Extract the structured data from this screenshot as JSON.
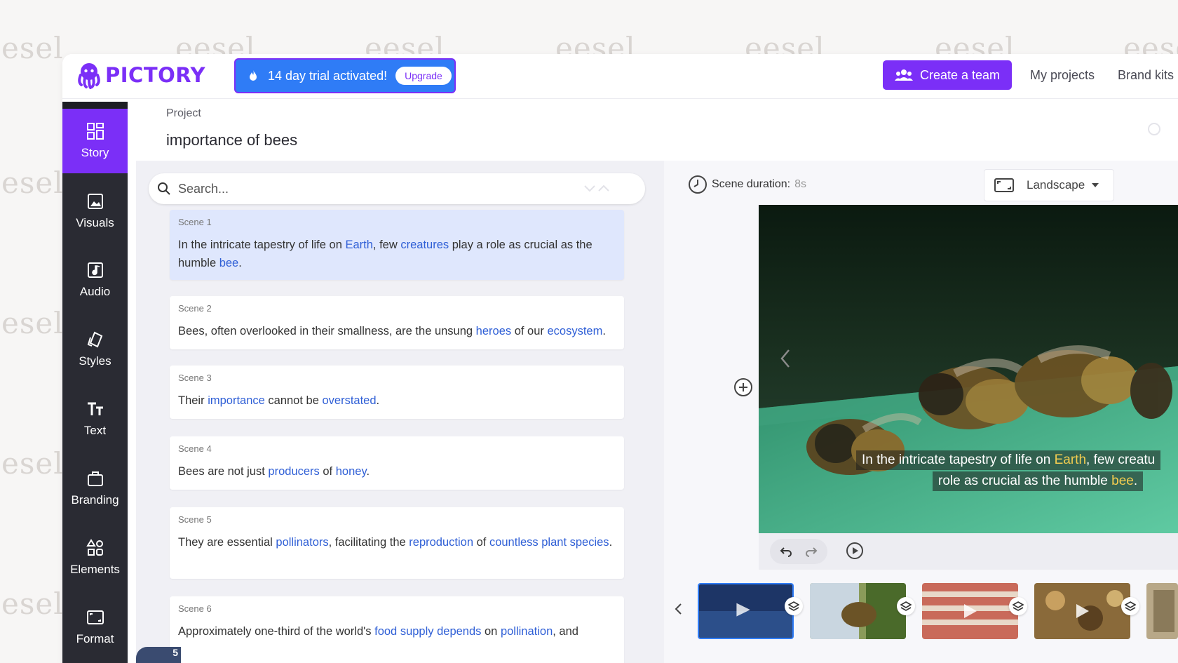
{
  "watermark": {
    "text_left": "esel",
    "text_top": "eesel"
  },
  "header": {
    "logo_text": "PICTORY",
    "trial_text": "14 day trial activated!",
    "upgrade_label": "Upgrade",
    "create_team_label": "Create a team",
    "nav": [
      "My projects",
      "Brand kits"
    ]
  },
  "sidebar": {
    "items": [
      {
        "label": "Story",
        "icon": "grid-icon",
        "active": true
      },
      {
        "label": "Visuals",
        "icon": "image-icon",
        "active": false
      },
      {
        "label": "Audio",
        "icon": "music-icon",
        "active": false
      },
      {
        "label": "Styles",
        "icon": "palette-icon",
        "active": false
      },
      {
        "label": "Text",
        "icon": "text-icon",
        "active": false
      },
      {
        "label": "Branding",
        "icon": "briefcase-icon",
        "active": false
      },
      {
        "label": "Elements",
        "icon": "shapes-icon",
        "active": false
      },
      {
        "label": "Format",
        "icon": "aspect-ratio-icon",
        "active": false
      }
    ]
  },
  "project": {
    "label": "Project",
    "title": "importance of bees"
  },
  "search": {
    "placeholder": "Search..."
  },
  "scenes": [
    {
      "label": "Scene 1"
    },
    {
      "label": "Scene 2"
    },
    {
      "label": "Scene 3"
    },
    {
      "label": "Scene 4"
    },
    {
      "label": "Scene 5"
    },
    {
      "label": "Scene 6"
    }
  ],
  "scene_texts": {
    "s1": [
      "In the intricate tapestry of life on ",
      "Earth",
      ", few ",
      "creatures",
      " play a role as crucial as the humble ",
      "bee",
      "."
    ],
    "s2": [
      "Bees, often overlooked in their smallness, are the unsung ",
      "heroes",
      " of our ",
      "ecosystem",
      "."
    ],
    "s3": [
      "Their ",
      "importance",
      " cannot be ",
      "overstated",
      "."
    ],
    "s4": [
      "Bees are not just ",
      "producers",
      " of ",
      "honey",
      "."
    ],
    "s5": [
      "They are essential ",
      "pollinators",
      ", facilitating the ",
      "reproduction",
      " of ",
      "countless plant species",
      "."
    ],
    "s6": [
      "Approximately one-third of the world's ",
      "food supply depends",
      " on ",
      "pollination",
      ", and"
    ]
  },
  "scene_badge": "5",
  "preview": {
    "duration_label": "Scene duration:",
    "duration_value": "8s",
    "aspect_label": "Landscape",
    "caption_line1_a": "In the intricate tapestry of life on ",
    "caption_line1_hl": "Earth",
    "caption_line1_b": ", few creatu",
    "caption_line2_a": "role as crucial as the humble ",
    "caption_line2_hl": "bee",
    "caption_line2_b": "."
  },
  "colors": {
    "brand": "#7b2ff7",
    "trial_blue": "#2f7cf6",
    "sidebar_bg": "#2a2b33",
    "keyword": "#2f5fd6",
    "caption_highlight": "#f3cd50"
  }
}
